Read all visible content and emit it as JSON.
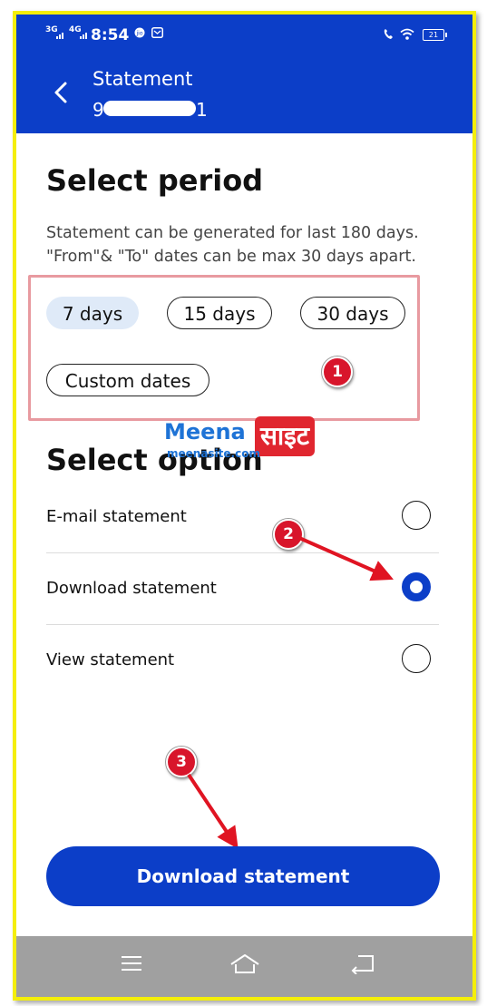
{
  "status_bar": {
    "network_1": "3G",
    "network_2": "4G",
    "time": "8:54",
    "battery": "21"
  },
  "header": {
    "title": "Statement",
    "number_start": "9",
    "number_end": "1"
  },
  "period": {
    "heading": "Select period",
    "description_line1": "Statement can be generated for last 180 days.",
    "description_line2": "\"From\"& \"To\" dates can be max 30 days apart.",
    "chips": [
      {
        "label": "7 days",
        "selected": true
      },
      {
        "label": "15 days",
        "selected": false
      },
      {
        "label": "30 days",
        "selected": false
      },
      {
        "label": "Custom dates",
        "selected": false
      }
    ]
  },
  "option": {
    "heading": "Select option",
    "items": [
      {
        "label": "E-mail statement",
        "selected": false
      },
      {
        "label": "Download statement",
        "selected": true
      },
      {
        "label": "View statement",
        "selected": false
      }
    ]
  },
  "primary_button": "Download statement",
  "annotations": {
    "marker_1": "1",
    "marker_2": "2",
    "marker_3": "3"
  },
  "watermark": {
    "brand_en": "Meena",
    "brand_hi": "साइट",
    "domain": "meenasite.com"
  },
  "colors": {
    "primary": "#0c3ec8",
    "chip_selected_bg": "#dfeaf8",
    "frame_border": "#f4ee0a",
    "annotation_red": "#d8152b"
  },
  "nav_icons": [
    "menu-icon",
    "home-icon",
    "back-icon"
  ]
}
